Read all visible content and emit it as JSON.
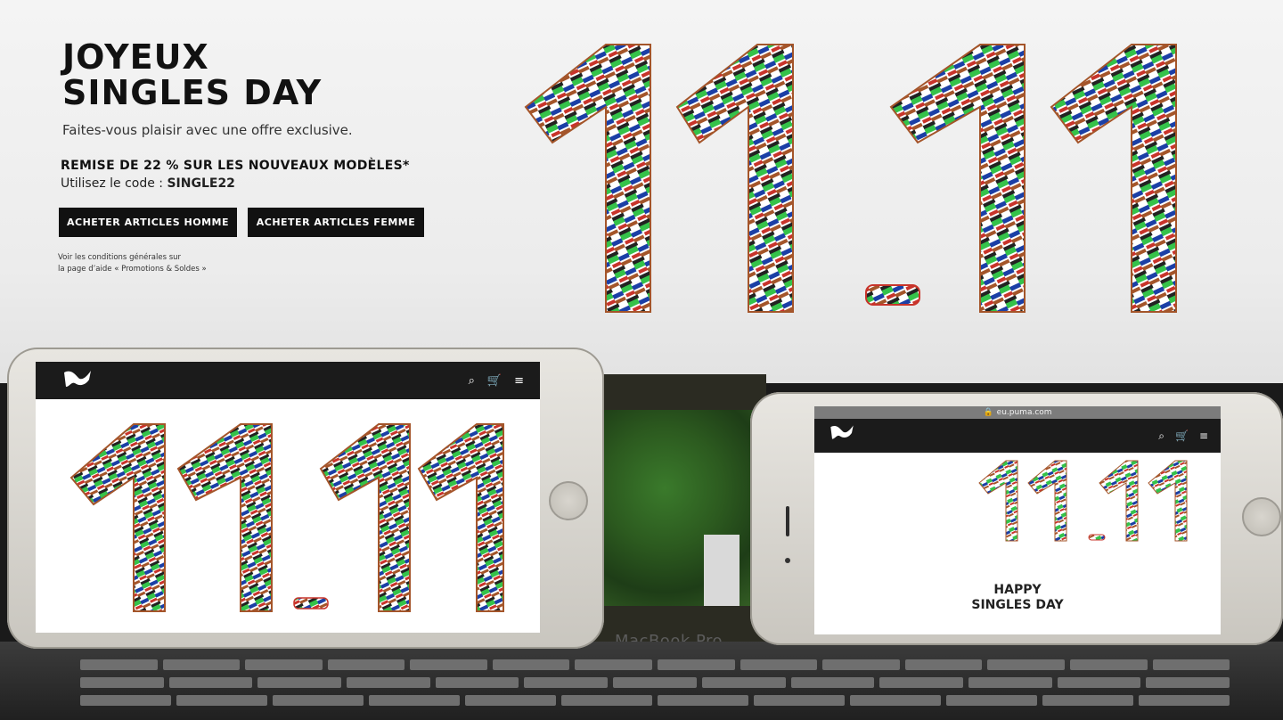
{
  "monitor": {
    "headline_line1": "JOYEUX",
    "headline_line2": "SINGLES DAY",
    "subtitle": "Faites-vous plaisir avec une offre exclusive.",
    "offer": "REMISE DE 22 % SUR LES NOUVEAUX MODÈLES*",
    "code_prefix": "Utilisez le code : ",
    "code": "SINGLE22",
    "button_homme": "ACHETER ARTICLES HOMME",
    "button_femme": "ACHETER ARTICLES FEMME",
    "terms_line1": "Voir les conditions générales sur",
    "terms_line2": "la page d’aide « Promotions & Soldes »",
    "art_text": "11.11"
  },
  "laptop": {
    "label": "MacBook Pro"
  },
  "phone_left": {
    "art_text": "11.11"
  },
  "phone_right": {
    "url": "eu.puma.com",
    "art_text": "11.11",
    "happy_line1": "HAPPY",
    "happy_line2": "SINGLES DAY"
  },
  "colors": {
    "dark": "#111111",
    "white": "#ffffff",
    "sneaker_green": "#35c24a",
    "sneaker_blue": "#1b3fa6",
    "sneaker_red": "#c8342b",
    "sneaker_brown": "#a4552a"
  }
}
